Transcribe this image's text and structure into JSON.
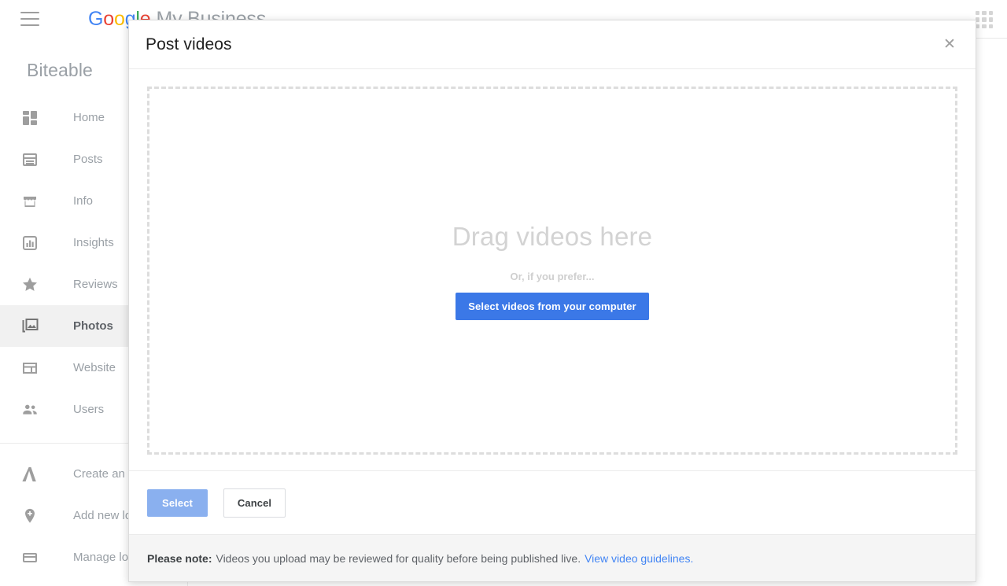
{
  "top_bar": {
    "menu_icon": "hamburger-menu-icon",
    "logo_letters": [
      "G",
      "o",
      "o",
      "g",
      "l",
      "e"
    ],
    "product_name": "My Business",
    "apps_icon": "apps-grid-icon"
  },
  "sidebar": {
    "business_name": "Biteable",
    "primary_items": [
      {
        "label": "Home",
        "icon": "home-dashboard-icon",
        "active": false
      },
      {
        "label": "Posts",
        "icon": "posts-icon",
        "active": false
      },
      {
        "label": "Info",
        "icon": "storefront-icon",
        "active": false
      },
      {
        "label": "Insights",
        "icon": "bar-chart-icon",
        "active": false
      },
      {
        "label": "Reviews",
        "icon": "star-icon",
        "active": false
      },
      {
        "label": "Photos",
        "icon": "photos-image-icon",
        "active": true
      },
      {
        "label": "Website",
        "icon": "website-layout-icon",
        "active": false
      },
      {
        "label": "Users",
        "icon": "users-people-icon",
        "active": false
      }
    ],
    "secondary_items": [
      {
        "label": "Create an ad",
        "icon": "adwords-icon"
      },
      {
        "label": "Add new location",
        "icon": "add-location-pin-icon"
      },
      {
        "label": "Manage locations",
        "icon": "manage-locations-icon"
      }
    ]
  },
  "modal": {
    "title": "Post videos",
    "close_icon": "close-x-icon",
    "drop_zone": {
      "headline": "Drag videos here",
      "subtext": "Or, if you prefer...",
      "button_label": "Select videos from your computer"
    },
    "actions": {
      "primary_label": "Select",
      "secondary_label": "Cancel"
    },
    "note": {
      "label": "Please note:",
      "text": "Videos you upload may be reviewed for quality before being published live.",
      "link_text": "View video guidelines."
    }
  },
  "colors": {
    "accent_blue": "#3b78e7",
    "link_blue": "#4285f4",
    "disabled_blue": "#8ab0ef",
    "note_bar_bg": "#f5f5f5",
    "active_nav_bg": "#f1f1f1"
  }
}
